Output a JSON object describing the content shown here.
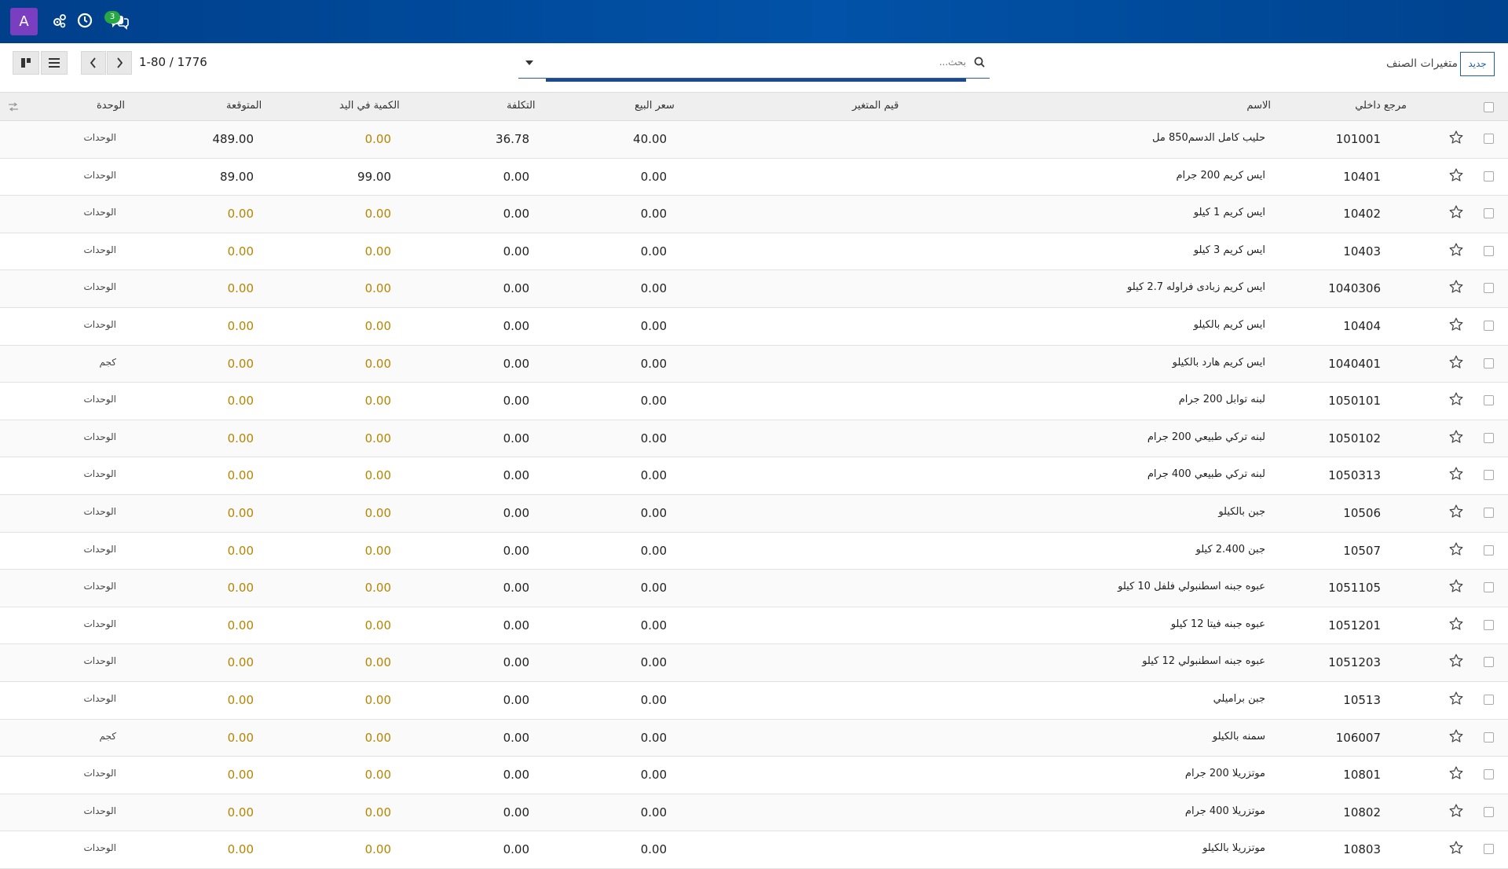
{
  "navbar": {
    "avatar_letter": "A",
    "messages_badge": "3"
  },
  "control_panel": {
    "breadcrumb": "متغيرات الصنف",
    "new_button": "جديد",
    "search_placeholder": "بحث...",
    "pager_value": "1-80 / 1776"
  },
  "table": {
    "columns": {
      "ref": "مرجع داخلي",
      "name": "الاسم",
      "variant_values": "قيم المتغير",
      "sale_price": "سعر البيع",
      "cost": "التكلفة",
      "qty_on_hand": "الكمية في اليد",
      "forecast": "المتوقعة",
      "uom": "الوحدة"
    },
    "rows": [
      {
        "ref": "101001",
        "name": "حليب كامل الدسم850 مل",
        "price": "40.00",
        "cost": "36.78",
        "qty": "0.00",
        "forecast": "489.00",
        "uom": "الوحدات"
      },
      {
        "ref": "10401",
        "name": "ايس كريم 200 جرام",
        "price": "0.00",
        "cost": "0.00",
        "qty": "99.00",
        "forecast": "89.00",
        "uom": "الوحدات"
      },
      {
        "ref": "10402",
        "name": "ايس كريم 1 كيلو",
        "price": "0.00",
        "cost": "0.00",
        "qty": "0.00",
        "forecast": "0.00",
        "uom": "الوحدات"
      },
      {
        "ref": "10403",
        "name": "ايس كريم 3 كيلو",
        "price": "0.00",
        "cost": "0.00",
        "qty": "0.00",
        "forecast": "0.00",
        "uom": "الوحدات"
      },
      {
        "ref": "1040306",
        "name": "ايس كريم زبادى فراوله 2.7 كيلو",
        "price": "0.00",
        "cost": "0.00",
        "qty": "0.00",
        "forecast": "0.00",
        "uom": "الوحدات"
      },
      {
        "ref": "10404",
        "name": "ايس كريم بالكيلو",
        "price": "0.00",
        "cost": "0.00",
        "qty": "0.00",
        "forecast": "0.00",
        "uom": "الوحدات"
      },
      {
        "ref": "1040401",
        "name": "ايس كريم هارد بالكيلو",
        "price": "0.00",
        "cost": "0.00",
        "qty": "0.00",
        "forecast": "0.00",
        "uom": "كجم"
      },
      {
        "ref": "1050101",
        "name": "لبنه توابل 200 جرام",
        "price": "0.00",
        "cost": "0.00",
        "qty": "0.00",
        "forecast": "0.00",
        "uom": "الوحدات"
      },
      {
        "ref": "1050102",
        "name": "لبنه تركي طبيعي 200 جرام",
        "price": "0.00",
        "cost": "0.00",
        "qty": "0.00",
        "forecast": "0.00",
        "uom": "الوحدات"
      },
      {
        "ref": "1050313",
        "name": "لبنه تركي طبيعي 400 جرام",
        "price": "0.00",
        "cost": "0.00",
        "qty": "0.00",
        "forecast": "0.00",
        "uom": "الوحدات"
      },
      {
        "ref": "10506",
        "name": "جبن بالكيلو",
        "price": "0.00",
        "cost": "0.00",
        "qty": "0.00",
        "forecast": "0.00",
        "uom": "الوحدات"
      },
      {
        "ref": "10507",
        "name": "جبن 2.400 كيلو",
        "price": "0.00",
        "cost": "0.00",
        "qty": "0.00",
        "forecast": "0.00",
        "uom": "الوحدات"
      },
      {
        "ref": "1051105",
        "name": "عبوه جبنه اسطنبولي فلفل 10 كيلو",
        "price": "0.00",
        "cost": "0.00",
        "qty": "0.00",
        "forecast": "0.00",
        "uom": "الوحدات"
      },
      {
        "ref": "1051201",
        "name": "عبوه جبنه فيتا 12 كيلو",
        "price": "0.00",
        "cost": "0.00",
        "qty": "0.00",
        "forecast": "0.00",
        "uom": "الوحدات"
      },
      {
        "ref": "1051203",
        "name": "عبوه جبنه اسطنبولي 12 كيلو",
        "price": "0.00",
        "cost": "0.00",
        "qty": "0.00",
        "forecast": "0.00",
        "uom": "الوحدات"
      },
      {
        "ref": "10513",
        "name": "جبن براميلي",
        "price": "0.00",
        "cost": "0.00",
        "qty": "0.00",
        "forecast": "0.00",
        "uom": "الوحدات"
      },
      {
        "ref": "106007",
        "name": "سمنه بالكيلو",
        "price": "0.00",
        "cost": "0.00",
        "qty": "0.00",
        "forecast": "0.00",
        "uom": "كجم"
      },
      {
        "ref": "10801",
        "name": "موتزريلا 200 جرام",
        "price": "0.00",
        "cost": "0.00",
        "qty": "0.00",
        "forecast": "0.00",
        "uom": "الوحدات"
      },
      {
        "ref": "10802",
        "name": "موتزريلا 400 جرام",
        "price": "0.00",
        "cost": "0.00",
        "qty": "0.00",
        "forecast": "0.00",
        "uom": "الوحدات"
      },
      {
        "ref": "10803",
        "name": "موتزريلا بالكيلو",
        "price": "0.00",
        "cost": "0.00",
        "qty": "0.00",
        "forecast": "0.00",
        "uom": "الوحدات"
      }
    ]
  },
  "colors": {
    "navbar": "#0152a8",
    "avatar": "#7a3ec0",
    "zero_value": "#b48500",
    "accent": "#1f5fa8"
  },
  "icons": {
    "navbar": [
      "settings-users-icon",
      "clock-icon",
      "chat-icon"
    ],
    "view_switcher": [
      "kanban-icon",
      "list-icon"
    ],
    "pager": [
      "chevron-left-icon",
      "chevron-right-icon"
    ],
    "row": [
      "star-icon"
    ]
  }
}
